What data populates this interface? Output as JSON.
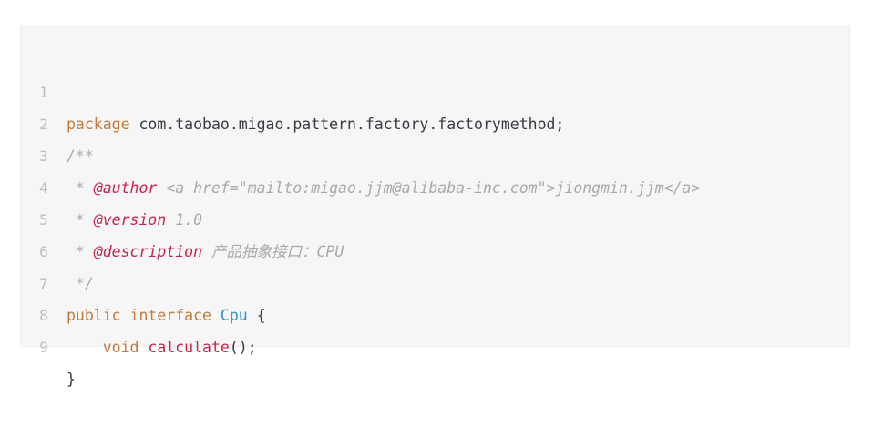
{
  "code": {
    "line_numbers": [
      "1",
      "2",
      "3",
      "4",
      "5",
      "6",
      "7",
      "8",
      "9"
    ],
    "l1": {
      "kw": "package",
      "rest": " com.taobao.migao.pattern.factory.factorymethod;"
    },
    "l2": {
      "comment": "/**"
    },
    "l3": {
      "lead": " * ",
      "tag": "@author",
      "rest": " <a href=\"mailto:migao.jjm@alibaba-inc.com\">jiongmin.jjm</a>"
    },
    "l4": {
      "lead": " * ",
      "tag": "@version",
      "rest": " 1.0"
    },
    "l5": {
      "lead": " * ",
      "tag": "@description",
      "rest": " 产品抽象接口：CPU"
    },
    "l6": {
      "comment": " */"
    },
    "l7": {
      "kw1": "public",
      "kw2": "interface",
      "type": "Cpu",
      "rest": " {"
    },
    "l8": {
      "indent": "    ",
      "kw": "void",
      "fn": "calculate",
      "rest": "();"
    },
    "l9": {
      "rest": "}"
    }
  }
}
